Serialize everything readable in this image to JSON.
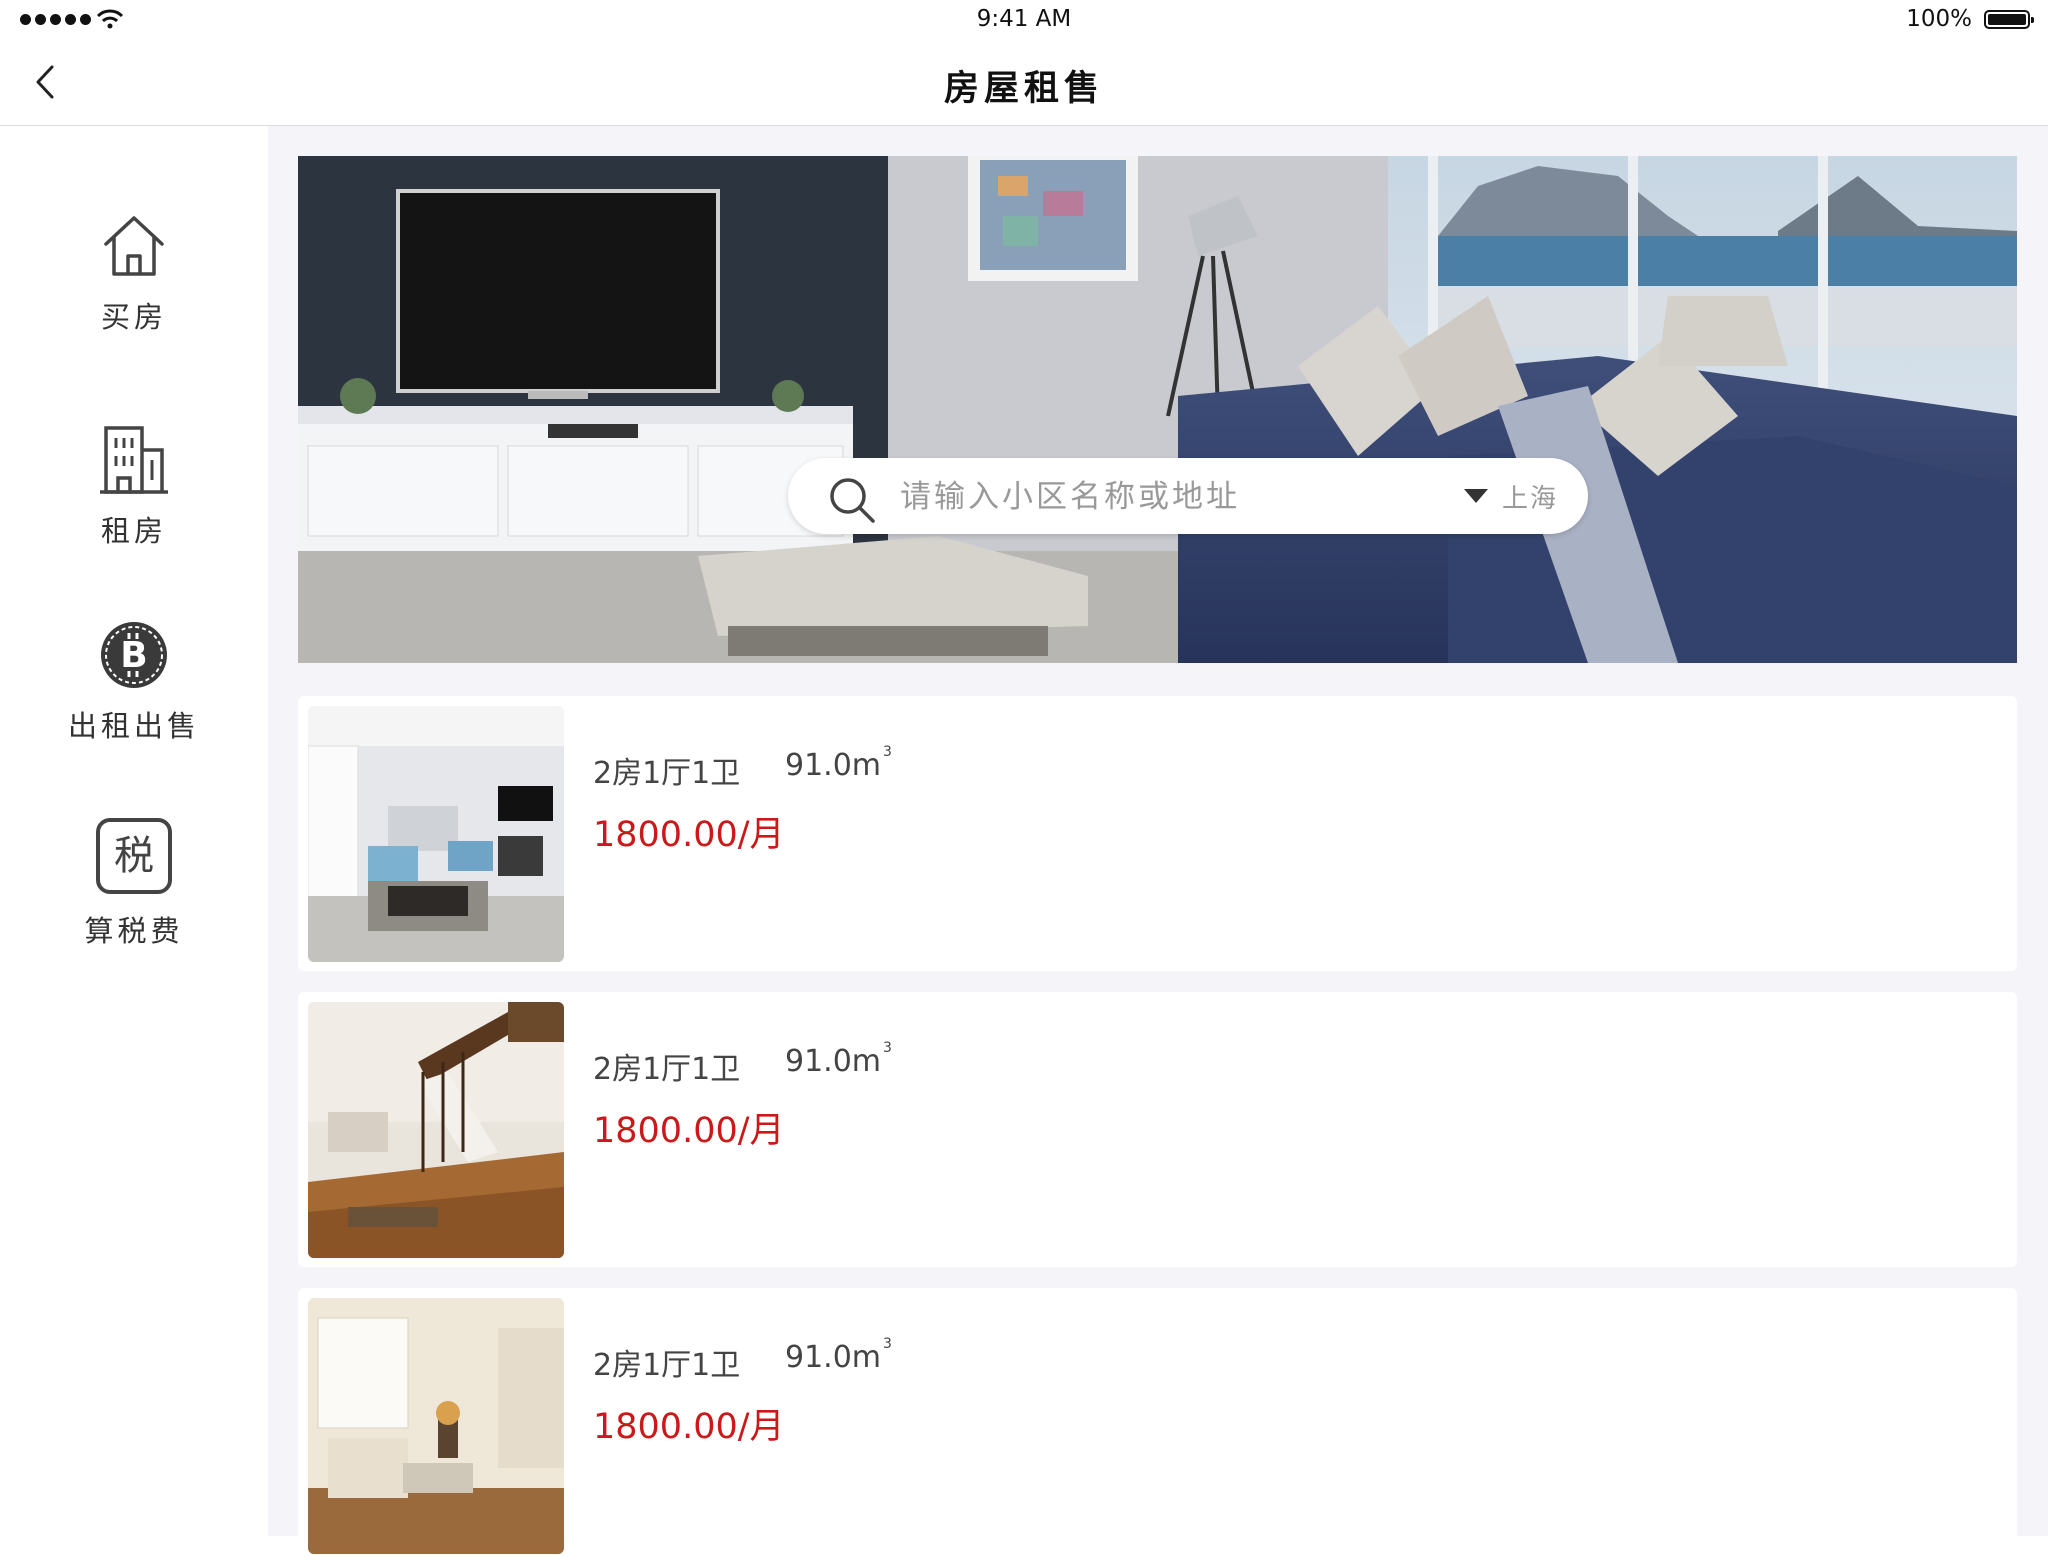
{
  "status_bar": {
    "time": "9:41 AM",
    "battery": "100%"
  },
  "nav": {
    "title": "房屋租售"
  },
  "sidebar": {
    "items": [
      {
        "label": "买房",
        "icon": "house-icon"
      },
      {
        "label": "租房",
        "icon": "building-icon"
      },
      {
        "label": "出租出售",
        "icon": "bitcoin-icon"
      },
      {
        "label": "算税费",
        "icon": "tax-icon",
        "icon_text": "税"
      }
    ]
  },
  "search": {
    "placeholder": "请输入小区名称或地址",
    "city": "上海"
  },
  "listings": [
    {
      "layout": "2房1厅1卫",
      "area": "91.0m",
      "area_unit_sup": "3",
      "price": "1800.00/月"
    },
    {
      "layout": "2房1厅1卫",
      "area": "91.0m",
      "area_unit_sup": "3",
      "price": "1800.00/月"
    },
    {
      "layout": "2房1厅1卫",
      "area": "91.0m",
      "area_unit_sup": "3",
      "price": "1800.00/月"
    }
  ],
  "colors": {
    "price": "#cc1818",
    "main_bg": "#f5f4f9",
    "divider": "#dcdcdc"
  }
}
